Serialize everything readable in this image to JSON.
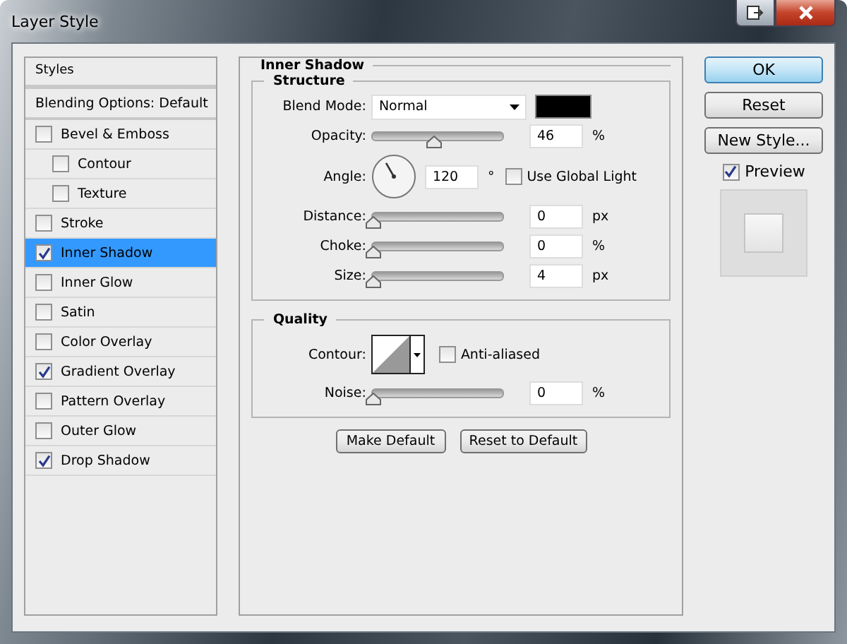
{
  "window": {
    "title": "Layer Style"
  },
  "sidebar": {
    "header": "Styles",
    "items": [
      {
        "kind": "plain",
        "label": "Blending Options: Default",
        "selected": false
      },
      {
        "kind": "check",
        "label": "Bevel & Emboss",
        "checked": false,
        "selected": false,
        "children": [
          {
            "kind": "check",
            "label": "Contour",
            "checked": false,
            "selected": false
          },
          {
            "kind": "check",
            "label": "Texture",
            "checked": false,
            "selected": false
          }
        ]
      },
      {
        "kind": "check",
        "label": "Stroke",
        "checked": false,
        "selected": false
      },
      {
        "kind": "check",
        "label": "Inner Shadow",
        "checked": true,
        "selected": true
      },
      {
        "kind": "check",
        "label": "Inner Glow",
        "checked": false,
        "selected": false
      },
      {
        "kind": "check",
        "label": "Satin",
        "checked": false,
        "selected": false
      },
      {
        "kind": "check",
        "label": "Color Overlay",
        "checked": false,
        "selected": false
      },
      {
        "kind": "check",
        "label": "Gradient Overlay",
        "checked": true,
        "selected": false
      },
      {
        "kind": "check",
        "label": "Pattern Overlay",
        "checked": false,
        "selected": false
      },
      {
        "kind": "check",
        "label": "Outer Glow",
        "checked": false,
        "selected": false
      },
      {
        "kind": "check",
        "label": "Drop Shadow",
        "checked": true,
        "selected": false
      }
    ]
  },
  "panel": {
    "title": "Inner Shadow",
    "structure": {
      "title": "Structure",
      "blend_mode": {
        "label": "Blend Mode:",
        "value": "Normal",
        "color": "#000000"
      },
      "rows": [
        {
          "kind": "slider",
          "label": "Opacity:",
          "level": 0.46,
          "value": "46",
          "unit": "%"
        },
        {
          "kind": "angle",
          "label": "Angle:",
          "value": "120",
          "unit": "°",
          "checkbox": {
            "label": "Use Global Light",
            "checked": false
          }
        },
        {
          "kind": "slider",
          "label": "Distance:",
          "level": 0,
          "value": "0",
          "unit": "px"
        },
        {
          "kind": "slider",
          "label": "Choke:",
          "level": 0,
          "value": "0",
          "unit": "%"
        },
        {
          "kind": "slider",
          "label": "Size:",
          "level": 0,
          "value": "4",
          "unit": "px"
        }
      ]
    },
    "quality": {
      "title": "Quality",
      "contour_label": "Contour:",
      "anti_aliased": {
        "label": "Anti-aliased",
        "checked": false
      },
      "rows": [
        {
          "kind": "slider",
          "label": "Noise:",
          "level": 0,
          "value": "0",
          "unit": "%"
        }
      ]
    },
    "buttons": [
      "Make Default",
      "Reset to Default"
    ]
  },
  "actions": [
    {
      "label": "OK",
      "default": true
    },
    {
      "label": "Reset",
      "default": false
    },
    {
      "label": "New Style...",
      "default": false
    }
  ],
  "preview": {
    "label": "Preview",
    "checked": true
  }
}
